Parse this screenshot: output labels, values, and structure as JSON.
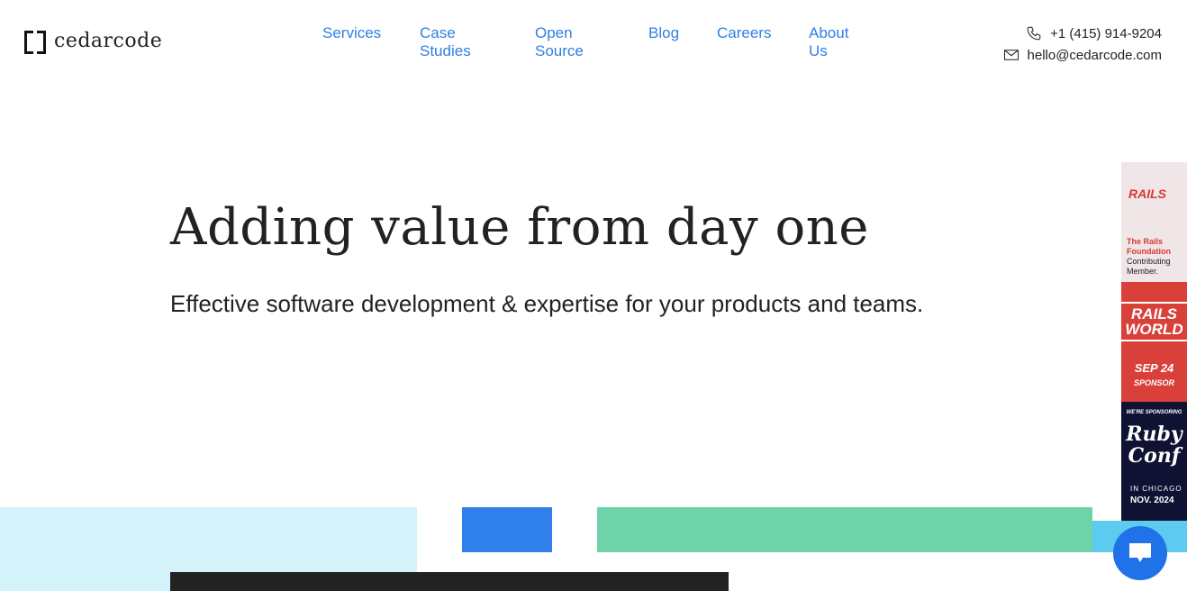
{
  "brand": {
    "name": "cedarcode"
  },
  "nav": [
    {
      "label": "Services"
    },
    {
      "label": "Case Studies"
    },
    {
      "label": "Open Source"
    },
    {
      "label": "Blog"
    },
    {
      "label": "Careers"
    },
    {
      "label": "About Us"
    }
  ],
  "contact": {
    "phone": "+1 (415) 914-9204",
    "email": "hello@cedarcode.com"
  },
  "hero": {
    "title": "Adding value from day one",
    "subtitle": "Effective software development & expertise for your products and teams."
  },
  "badges": {
    "rails_foundation": {
      "logo": "RAILS",
      "line1": "The Rails",
      "line2": "Foundation",
      "line3": "Contributing",
      "line4": "Member."
    },
    "rails_world": {
      "title1": "RAILS",
      "title2": "WORLD",
      "date": "SEP 24",
      "role": "SPONSOR"
    },
    "rubyconf": {
      "top": "WE'RE SPONSORING",
      "title1": "Ruby",
      "title2": "Conf",
      "place": "IN CHICAGO",
      "date": "NOV. 2024"
    }
  },
  "colors": {
    "link": "#2f80e4",
    "blue_block": "#2f80eb",
    "green_block": "#6cd4a8",
    "cyan_block": "#d3f2f9",
    "chat": "#1f72e8"
  }
}
